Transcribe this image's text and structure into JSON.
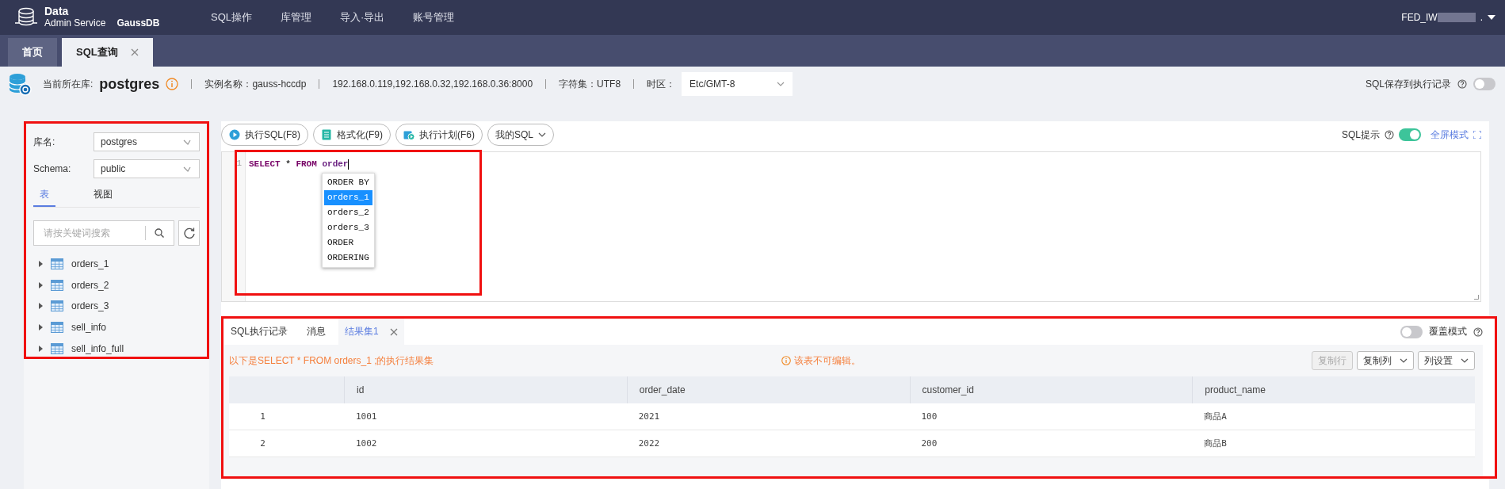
{
  "header": {
    "brand_line1": "Data",
    "brand_line2": "Admin Service",
    "product": "GaussDB",
    "menu": [
      "SQL操作",
      "库管理",
      "导入·导出",
      "账号管理"
    ],
    "user": "FED_IW",
    "user_suffix": "."
  },
  "tabs": [
    {
      "label": "首页",
      "selected": false,
      "closable": false
    },
    {
      "label": "SQL查询",
      "selected": true,
      "closable": true
    }
  ],
  "infobar": {
    "db_label": "当前所在库:",
    "db_name": "postgres",
    "instance": "实例名称：gauss-hccdp",
    "address": "192.168.0.119,192.168.0.32,192.168.0.36:8000",
    "charset": "字符集：UTF8",
    "timezone_label": "时区：",
    "timezone": "Etc/GMT-8",
    "save_label": "SQL保存到执行记录",
    "save_on": false
  },
  "sidebar": {
    "highlighted": true,
    "fields": [
      {
        "label": "库名:",
        "value": "postgres"
      },
      {
        "label": "Schema:",
        "value": "public"
      }
    ],
    "tabs": [
      {
        "label": "表",
        "selected": true
      },
      {
        "label": "视图",
        "selected": false
      }
    ],
    "search": {
      "placeholder": "请按关键词搜索"
    },
    "items": [
      {
        "label": "orders_1",
        "expanded": false
      },
      {
        "label": "orders_2",
        "expanded": false
      },
      {
        "label": "orders_3",
        "expanded": false
      },
      {
        "label": "sell_info",
        "expanded": false
      },
      {
        "label": "sell_info_full",
        "expanded": false
      }
    ]
  },
  "toolbar": {
    "buttons": [
      {
        "label": "执行SQL(F8)",
        "kind": "icon"
      },
      {
        "label": "格式化(F9)",
        "kind": "icon"
      },
      {
        "label": "执行计划(F6)",
        "kind": "icon"
      },
      {
        "label": "我的SQL",
        "kind": "dropdown"
      }
    ],
    "hint_label": "SQL提示",
    "hint_on": true,
    "fullscreen": "全屏模式"
  },
  "editor": {
    "highlighted": true,
    "lines": [
      {
        "number": "1",
        "tokens": [
          {
            "text": "SELECT",
            "kind": "keyword"
          },
          {
            "text": " * ",
            "kind": "operator"
          },
          {
            "text": "FROM",
            "kind": "keyword"
          },
          {
            "text": " order",
            "kind": "identifier"
          }
        ]
      }
    ],
    "suggestions": [
      {
        "label": "ORDER BY",
        "selected": false
      },
      {
        "label": "orders_1",
        "selected": true
      },
      {
        "label": "orders_2",
        "selected": false
      },
      {
        "label": "orders_3",
        "selected": false
      },
      {
        "label": "ORDER",
        "selected": false
      },
      {
        "label": "ORDERING",
        "selected": false
      }
    ]
  },
  "results": {
    "highlighted": true,
    "tabs": [
      {
        "label": "SQL执行记录",
        "selected": false,
        "closable": false
      },
      {
        "label": "消息",
        "selected": false,
        "closable": false
      },
      {
        "label": "结果集1",
        "selected": true,
        "closable": true
      }
    ],
    "overlay_label": "覆盖模式",
    "overlay_on": false,
    "summary": "以下是SELECT * FROM orders_1 ;的执行结果集",
    "notice": "该表不可编辑。",
    "actions": [
      {
        "label": "复制行",
        "disabled": true,
        "dropdown": false
      },
      {
        "label": "复制列",
        "disabled": false,
        "dropdown": true
      },
      {
        "label": "列设置",
        "disabled": false,
        "dropdown": true
      }
    ],
    "table": {
      "columns": [
        "id",
        "order_date",
        "customer_id",
        "product_name"
      ],
      "rows": [
        {
          "number": "1",
          "cells": [
            "1001",
            "2021",
            "100",
            "商品A"
          ]
        },
        {
          "number": "2",
          "cells": [
            "1002",
            "2022",
            "200",
            "商品B"
          ]
        }
      ]
    }
  }
}
